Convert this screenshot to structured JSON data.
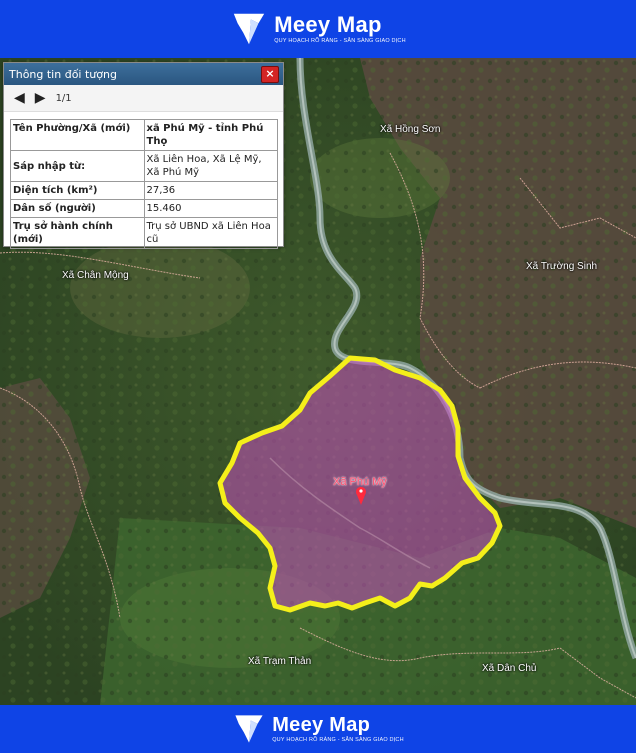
{
  "brand": {
    "name": "Meey Map",
    "tagline": "QUY HOẠCH RÕ RÀNG - SẴN SÀNG GIAO DỊCH"
  },
  "panel": {
    "title": "Thông tin đối tượng",
    "close": "×",
    "pager": "1/1",
    "rows": [
      {
        "key": "Tên Phường/Xã (mới)",
        "value": "xã Phú Mỹ - tỉnh Phú Thọ"
      },
      {
        "key": "Sáp nhập từ:",
        "value": "Xã Liên Hoa, Xã Lệ Mỹ, Xã Phú Mỹ"
      },
      {
        "key": "Diện tích (km²)",
        "value": "27,36"
      },
      {
        "key": "Dân số (người)",
        "value": "15.460"
      },
      {
        "key": "Trụ sở hành chính (mới)",
        "value": "Trụ sở UBND xã Liên Hoa cũ"
      }
    ]
  },
  "places": {
    "hong_son": "Xã Hồng Sơn",
    "chan_mong": "Xã Chân Mộng",
    "truong_sinh": "Xã Trường Sinh",
    "phu_my": "Xã Phú Mỹ",
    "tram_than": "Xã Trạm Thản",
    "dan_chu": "Xã Dân Chủ"
  },
  "colors": {
    "highlight_fill": "#c74fc0",
    "highlight_outline": "#f4ef1a",
    "brand_blue": "#0f44e6"
  }
}
